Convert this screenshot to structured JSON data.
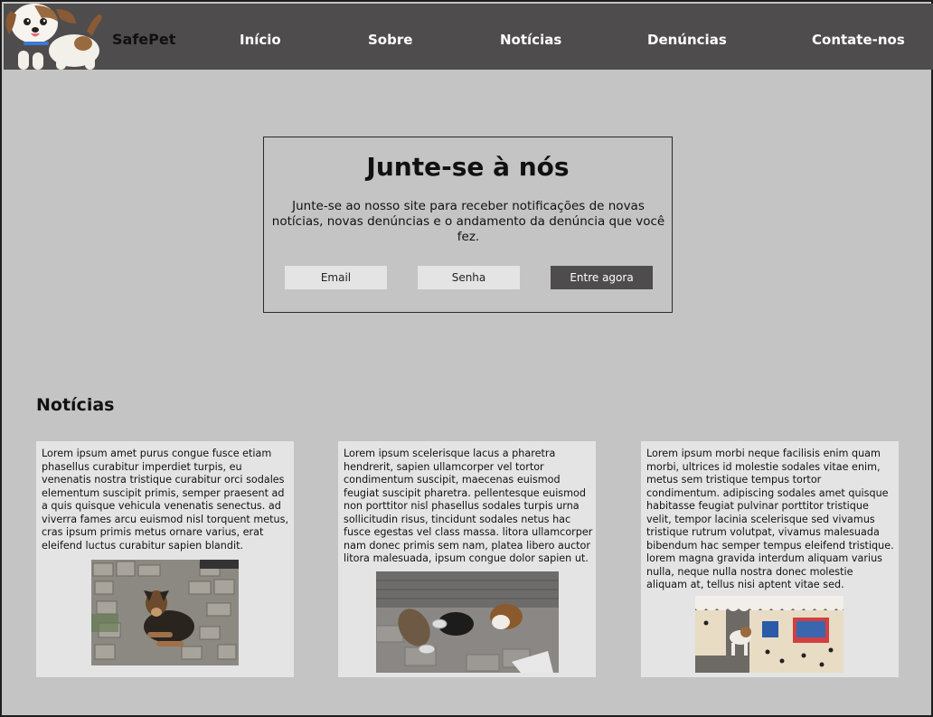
{
  "header": {
    "brand": "SafePet",
    "nav": [
      "Início",
      "Sobre",
      "Notícias",
      "Denúncias",
      "Contate-nos"
    ]
  },
  "join": {
    "title": "Junte-se à nós",
    "text": "Junte-se ao nosso site para receber notificações de novas notícias, novas denúncias e o andamento da denúncia que você fez.",
    "email_label": "Email",
    "password_label": "Senha",
    "submit_label": "Entre agora"
  },
  "news": {
    "heading": "Notícias",
    "cards": [
      {
        "text": "Lorem ipsum amet purus congue fusce etiam phasellus curabitur imperdiet turpis, eu venenatis nostra tristique curabitur orci sodales elementum suscipit primis, semper praesent ad a quis quisque vehicula venenatis senectus. ad viverra fames arcu euismod nisl torquent metus, cras ipsum primis metus ornare varius, erat eleifend luctus curabitur sapien blandit.",
        "image": "dog-on-cobblestone-photo"
      },
      {
        "text": "Lorem ipsum scelerisque lacus a pharetra hendrerit, sapien ullamcorper vel tortor condimentum suscipit, maecenas euismod feugiat suscipit pharetra. pellentesque euismod non porttitor nisl phasellus sodales turpis urna sollicitudin risus, tincidunt sodales netus hac fusce egestas vel class massa. litora ullamcorper nam donec primis sem nam, platea libero auctor litora malesuada, ipsum congue dolor sapien ut.",
        "image": "street-cats-eating-photo"
      },
      {
        "text": "Lorem ipsum morbi neque facilisis enim quam morbi, ultrices id molestie sodales vitae enim, metus sem tristique tempus tortor condimentum. adipiscing sodales amet quisque habitasse feugiat pulvinar porttitor tristique velit, tempor lacinia scelerisque sed vivamus tristique rutrum volutpat, vivamus malesuada bibendum hac semper tempus eleifend tristique. lorem magna gravida interdum aliquam varius nulla, neque nulla nostra donec molestie aliquam at, tellus nisi aptent vitae sed.",
        "image": "dog-shelter-house-photo"
      }
    ]
  }
}
